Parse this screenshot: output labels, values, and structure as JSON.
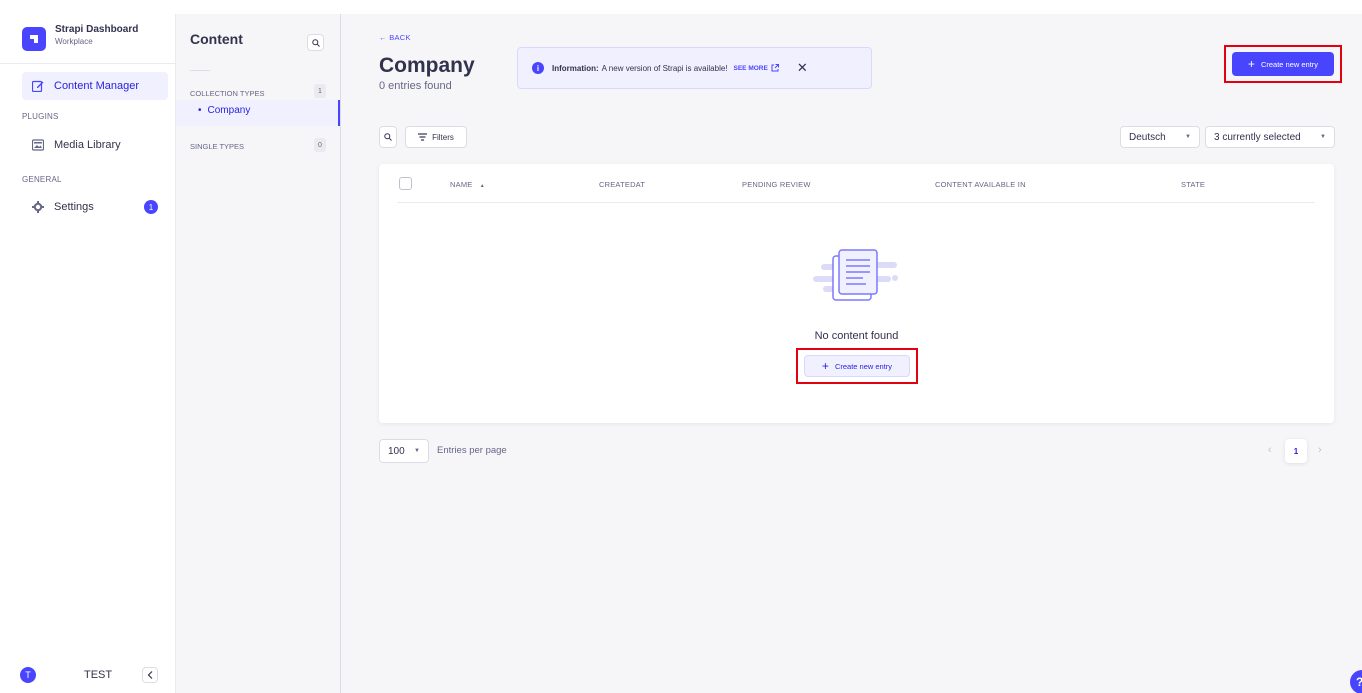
{
  "brand": {
    "title": "Strapi Dashboard",
    "subtitle": "Workplace"
  },
  "mainnav": {
    "content_manager": "Content Manager",
    "plugins_section": "PLUGINS",
    "media_library": "Media Library",
    "general_section": "GENERAL",
    "settings": "Settings",
    "settings_badge": "1"
  },
  "user": {
    "initial": "T",
    "name": "TEST"
  },
  "subnav": {
    "title": "Content",
    "collection_types": "COLLECTION TYPES",
    "collection_count": "1",
    "company_link": "Company",
    "single_types": "SINGLE TYPES",
    "single_count": "0"
  },
  "header": {
    "back": "BACK",
    "title": "Company",
    "subtitle": "0 entries found",
    "create_label": "Create new entry"
  },
  "alert": {
    "label": "Information:",
    "text": "A new version of Strapi is available!",
    "link": "SEE MORE"
  },
  "toolbar": {
    "filters": "Filters",
    "locale": "Deutsch",
    "columns": "3 currently selected"
  },
  "table": {
    "headers": [
      "NAME",
      "CREATEDAT",
      "PENDING REVIEW",
      "CONTENT AVAILABLE IN",
      "STATE"
    ],
    "sort_indicator": "▲",
    "empty_text": "No content found",
    "create_label": "Create new entry"
  },
  "footer": {
    "page_size": "100",
    "page_size_label": "Entries per page",
    "current_page": "1"
  },
  "help": "?",
  "colors": {
    "primary": "#4945ff",
    "primary_light": "#f0f0ff",
    "highlight": "#e3000f"
  }
}
